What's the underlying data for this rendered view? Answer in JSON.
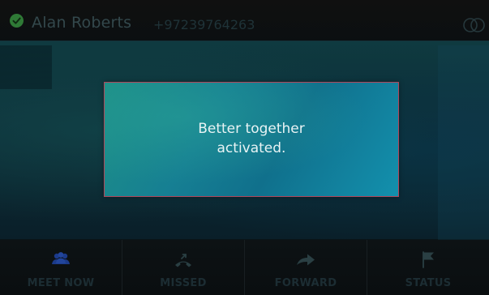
{
  "header": {
    "user_name": "Alan Roberts",
    "phone_number": "+97239764263",
    "presence_status": "available",
    "presence_color": "#2f7a36",
    "pair_icon": "better-together-icon"
  },
  "dialog": {
    "message_line1": "Better together",
    "message_line2": "activated.",
    "border_color": "#b0475a",
    "background_color": "#167f93"
  },
  "softkeys": [
    {
      "label": "MEET NOW",
      "icon": "meet-now-icon",
      "icon_color": "#1b3a8a"
    },
    {
      "label": "MISSED",
      "icon": "missed-call-icon",
      "icon_color": "#2a3f43"
    },
    {
      "label": "FORWARD",
      "icon": "forward-icon",
      "icon_color": "#2a3f43"
    },
    {
      "label": "STATUS",
      "icon": "flag-icon",
      "icon_color": "#2a3f43"
    }
  ]
}
